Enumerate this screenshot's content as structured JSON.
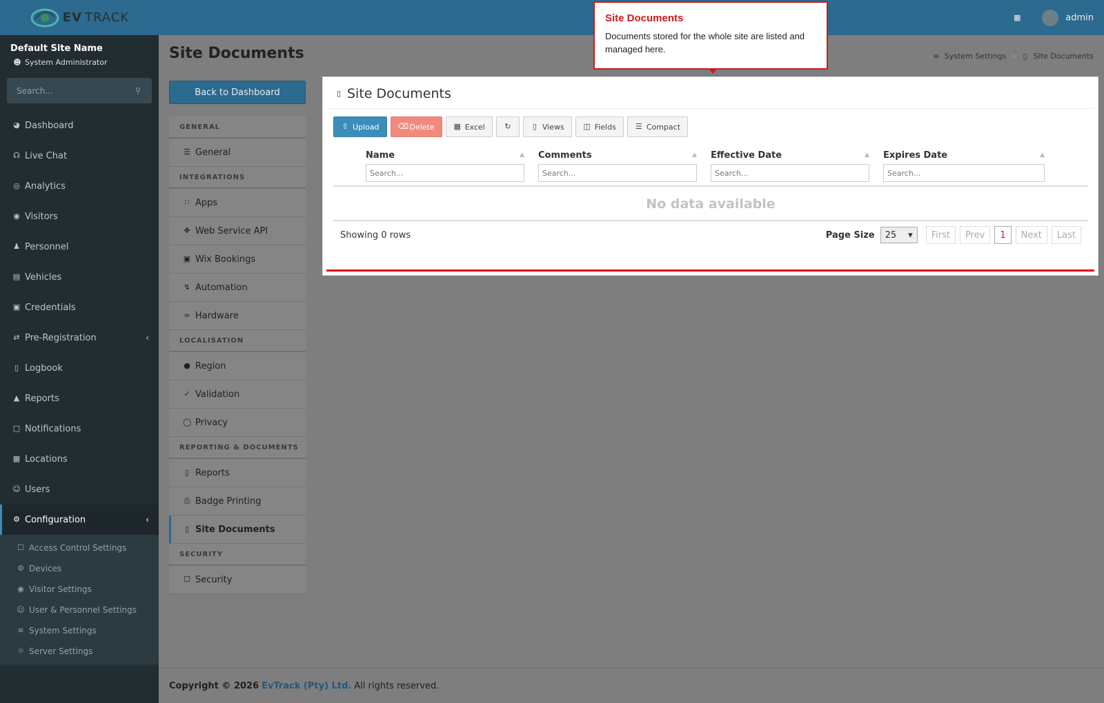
{
  "brand": {
    "ev": "EV",
    "track": "TRACK"
  },
  "user_panel": {
    "site_name": "Default Site Name",
    "role": "System Administrator"
  },
  "sidebar": {
    "search_placeholder": "Search...",
    "items": [
      {
        "label": "Dashboard",
        "icon": "dashboard-icon"
      },
      {
        "label": "Live Chat",
        "icon": "headset-icon"
      },
      {
        "label": "Analytics",
        "icon": "target-icon"
      },
      {
        "label": "Visitors",
        "icon": "eye-icon"
      },
      {
        "label": "Personnel",
        "icon": "user-tie-icon"
      },
      {
        "label": "Vehicles",
        "icon": "car-icon"
      },
      {
        "label": "Credentials",
        "icon": "id-badge-icon"
      },
      {
        "label": "Pre-Registration",
        "icon": "exchange-icon"
      },
      {
        "label": "Logbook",
        "icon": "book-icon"
      },
      {
        "label": "Reports",
        "icon": "chart-area-icon"
      },
      {
        "label": "Notifications",
        "icon": "comments-icon"
      },
      {
        "label": "Locations",
        "icon": "map-icon"
      },
      {
        "label": "Users",
        "icon": "users-cog-icon"
      },
      {
        "label": "Configuration",
        "icon": "cog-icon"
      }
    ],
    "submenu": [
      {
        "label": "Access Control Settings",
        "icon": "lock-icon"
      },
      {
        "label": "Devices",
        "icon": "cog-icon"
      },
      {
        "label": "Visitor Settings",
        "icon": "eye-icon"
      },
      {
        "label": "User & Personnel Settings",
        "icon": "users-cog-icon"
      },
      {
        "label": "System Settings",
        "icon": "sliders-icon"
      },
      {
        "label": "Server Settings",
        "icon": "user-shield-icon"
      }
    ]
  },
  "topbar": {
    "user": "admin"
  },
  "page": {
    "title": "Site Documents",
    "breadcrumb": [
      "System Settings",
      "Site Documents"
    ],
    "back_label": "Back to Dashboard"
  },
  "settings_nav": {
    "sections": [
      {
        "header": "GENERAL",
        "items": [
          {
            "label": "General",
            "icon": "list-icon"
          }
        ]
      },
      {
        "header": "INTEGRATIONS",
        "items": [
          {
            "label": "Apps",
            "icon": "grid-icon"
          },
          {
            "label": "Web Service API",
            "icon": "arrows-icon"
          },
          {
            "label": "Wix Bookings",
            "icon": "calendar-icon"
          },
          {
            "label": "Automation",
            "icon": "bolt-icon"
          },
          {
            "label": "Hardware",
            "icon": "fingerprint-icon"
          }
        ]
      },
      {
        "header": "LOCALISATION",
        "items": [
          {
            "label": "Region",
            "icon": "globe-icon"
          },
          {
            "label": "Validation",
            "icon": "check-circle-icon"
          },
          {
            "label": "Privacy",
            "icon": "shield-icon"
          }
        ]
      },
      {
        "header": "REPORTING & DOCUMENTS",
        "items": [
          {
            "label": "Reports",
            "icon": "bar-chart-icon"
          },
          {
            "label": "Badge Printing",
            "icon": "print-icon"
          },
          {
            "label": "Site Documents",
            "icon": "file-icon"
          }
        ]
      },
      {
        "header": "SECURITY",
        "items": [
          {
            "label": "Security",
            "icon": "lock-icon"
          }
        ]
      }
    ]
  },
  "panel": {
    "title": "Site Documents",
    "toolbar": {
      "upload": "Upload",
      "delete": "Delete",
      "excel": "Excel",
      "views": "Views",
      "fields": "Fields",
      "compact": "Compact"
    },
    "columns": [
      {
        "label": "Name",
        "placeholder": "Search..."
      },
      {
        "label": "Comments",
        "placeholder": "Search..."
      },
      {
        "label": "Effective Date",
        "placeholder": "Search..."
      },
      {
        "label": "Expires Date",
        "placeholder": "Search..."
      }
    ],
    "empty": "No data available",
    "showing": "Showing 0 rows",
    "page_size_label": "Page Size",
    "page_size": "25",
    "pager": {
      "first": "First",
      "prev": "Prev",
      "current": "1",
      "next": "Next",
      "last": "Last"
    }
  },
  "tooltip": {
    "title": "Site Documents",
    "body": "Documents stored for the whole site are listed and managed here."
  },
  "footer": {
    "copyright": "Copyright © 2026",
    "company": "EvTrack (Pty) Ltd.",
    "rights": "All rights reserved."
  },
  "colors": {
    "brand": "#2c6a8f",
    "sidebar": "#222d32",
    "accent_red": "#d01818",
    "primary": "#3c8dbc"
  }
}
